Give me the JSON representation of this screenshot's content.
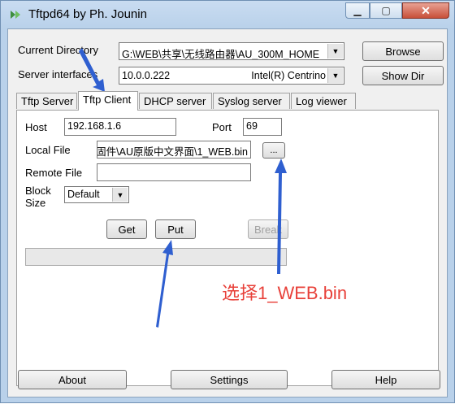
{
  "window": {
    "title": "Tftpd64 by Ph. Jounin",
    "minimize_glyph": "▁",
    "maximize_glyph": "▢",
    "close_glyph": "✕"
  },
  "top": {
    "current_directory_label": "Current Directory",
    "current_directory_value": "G:\\WEB\\共享\\无线路由器\\AU_300M_HOME",
    "server_interface_label": "Server interfaces",
    "server_interface_ip": "10.0.0.222",
    "server_interface_adapter": "Intel(R) Centrino",
    "browse_label": "Browse",
    "show_dir_label": "Show Dir"
  },
  "tabs": [
    {
      "label": "Tftp Server"
    },
    {
      "label": "Tftp Client",
      "active": true
    },
    {
      "label": "DHCP server"
    },
    {
      "label": "Syslog server"
    },
    {
      "label": "Log viewer"
    }
  ],
  "client": {
    "host_label": "Host",
    "host_value": "192.168.1.6",
    "port_label": "Port",
    "port_value": "69",
    "local_file_label": "Local File",
    "local_file_value": "固件\\AU原版中文界面\\1_WEB.bin",
    "ellipsis_label": "...",
    "remote_file_label": "Remote File",
    "remote_file_value": "",
    "block_size_label_1": "Block",
    "block_size_label_2": "Size",
    "block_size_value": "Default",
    "get_label": "Get",
    "put_label": "Put",
    "break_label": "Break",
    "progress_fraction": 0
  },
  "annotation": {
    "text": "选择1_WEB.bin",
    "color": "#e8413a",
    "arrow_color": "#2f5fd0"
  },
  "bottom": {
    "about_label": "About",
    "settings_label": "Settings",
    "help_label": "Help"
  },
  "icons": {
    "app": "tftpd-app-icon",
    "dropdown": "chevron-down-icon"
  }
}
